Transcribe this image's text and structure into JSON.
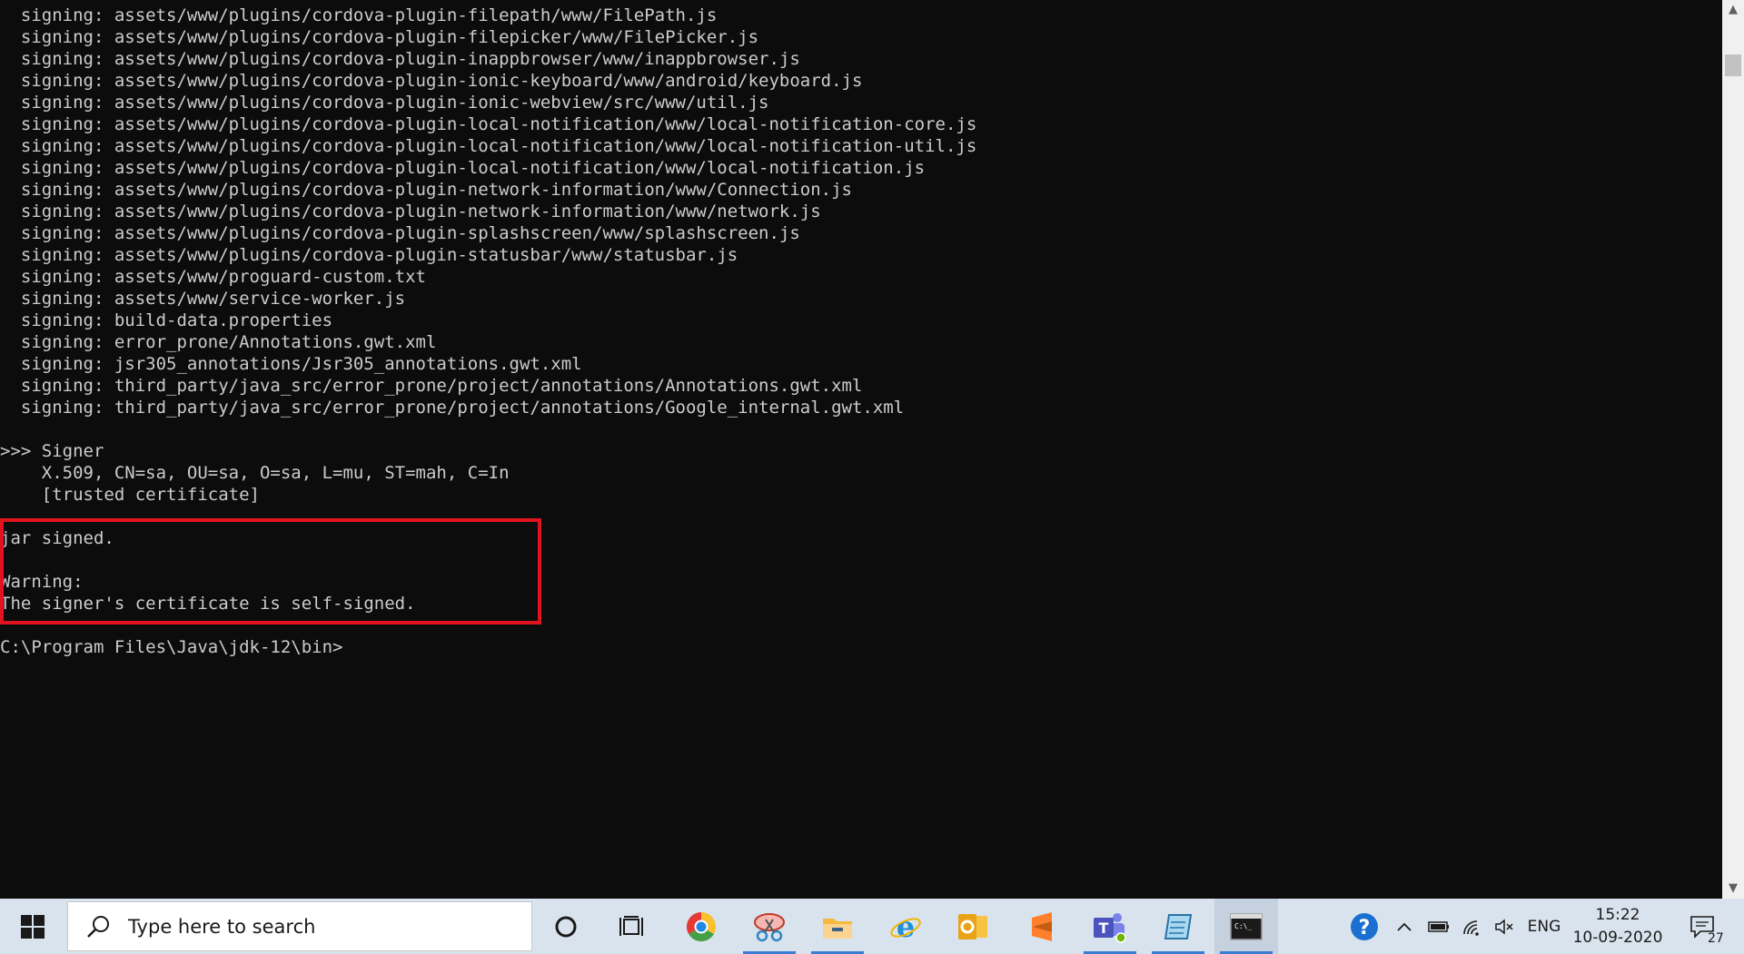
{
  "console": {
    "lines": [
      "  signing: assets/www/plugins/cordova-plugin-filepath/www/FilePath.js",
      "  signing: assets/www/plugins/cordova-plugin-filepicker/www/FilePicker.js",
      "  signing: assets/www/plugins/cordova-plugin-inappbrowser/www/inappbrowser.js",
      "  signing: assets/www/plugins/cordova-plugin-ionic-keyboard/www/android/keyboard.js",
      "  signing: assets/www/plugins/cordova-plugin-ionic-webview/src/www/util.js",
      "  signing: assets/www/plugins/cordova-plugin-local-notification/www/local-notification-core.js",
      "  signing: assets/www/plugins/cordova-plugin-local-notification/www/local-notification-util.js",
      "  signing: assets/www/plugins/cordova-plugin-local-notification/www/local-notification.js",
      "  signing: assets/www/plugins/cordova-plugin-network-information/www/Connection.js",
      "  signing: assets/www/plugins/cordova-plugin-network-information/www/network.js",
      "  signing: assets/www/plugins/cordova-plugin-splashscreen/www/splashscreen.js",
      "  signing: assets/www/plugins/cordova-plugin-statusbar/www/statusbar.js",
      "  signing: assets/www/proguard-custom.txt",
      "  signing: assets/www/service-worker.js",
      "  signing: build-data.properties",
      "  signing: error_prone/Annotations.gwt.xml",
      "  signing: jsr305_annotations/Jsr305_annotations.gwt.xml",
      "  signing: third_party/java_src/error_prone/project/annotations/Annotations.gwt.xml",
      "  signing: third_party/java_src/error_prone/project/annotations/Google_internal.gwt.xml",
      "",
      ">>> Signer",
      "    X.509, CN=sa, OU=sa, O=sa, L=mu, ST=mah, C=In",
      "    [trusted certificate]",
      "",
      "jar signed.",
      "",
      "Warning:",
      "The signer's certificate is self-signed.",
      "",
      "C:\\Program Files\\Java\\jdk-12\\bin>"
    ]
  },
  "taskbar": {
    "search_placeholder": "Type here to search",
    "icons": [
      "cortana-icon",
      "task-view-icon",
      "chrome-icon",
      "snipping-tool-icon",
      "file-explorer-icon",
      "internet-explorer-icon",
      "outlook-icon",
      "sublime-text-icon",
      "teams-icon",
      "notepad-icon",
      "command-prompt-icon"
    ],
    "tray": {
      "language": "ENG",
      "time": "15:22",
      "date": "10-09-2020",
      "notification_count": "27"
    }
  },
  "colors": {
    "console_bg": "#0c0c0c",
    "console_text": "#cccccc",
    "highlight": "#e0141e",
    "taskbar_bg": "#d9e3ed"
  }
}
